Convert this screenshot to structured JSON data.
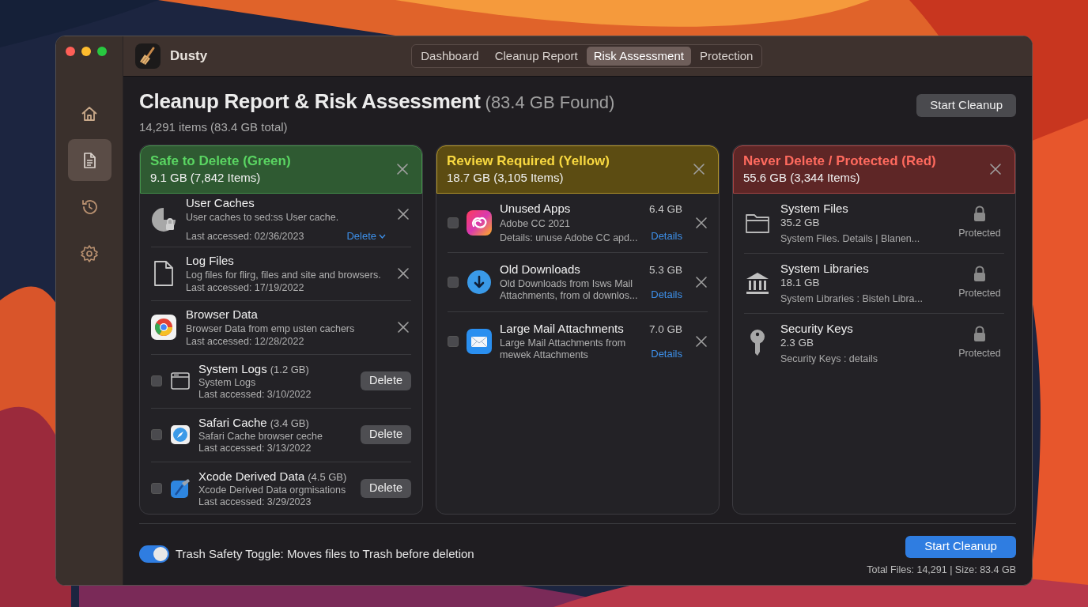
{
  "app": {
    "name": "Dusty"
  },
  "tabs": [
    {
      "label": "Dashboard",
      "selected": false
    },
    {
      "label": "Cleanup Report",
      "selected": false
    },
    {
      "label": "Risk Assessment",
      "selected": true
    },
    {
      "label": "Protection",
      "selected": false
    }
  ],
  "sidebar": {
    "items": [
      {
        "kind": "home",
        "selected": false
      },
      {
        "kind": "report",
        "selected": true
      },
      {
        "kind": "history",
        "selected": false
      },
      {
        "kind": "settings",
        "selected": false
      }
    ]
  },
  "header": {
    "title": "Cleanup Report & Risk Assessment",
    "found": "(83.4 GB Found)",
    "subtitle": "14,291 items (83.4 GB total)",
    "button": "Start Cleanup"
  },
  "columns": [
    {
      "color": "#5ad562",
      "title": "Safe to Delete (Green)",
      "summary": "9.1 GB (7,842 Items)",
      "items": [
        {
          "kind": "dismiss",
          "name": "User Caches",
          "description": "User caches to sed:ss User cache.",
          "accessed": "Last accessed: 02/36/2023",
          "action": "Delete"
        },
        {
          "kind": "dismiss",
          "name": "Log Files",
          "description": "Log files for flirg, files and site and browsers.",
          "accessed": "Last accessed: 17/19/2022"
        },
        {
          "kind": "dismiss",
          "name": "Browser Data",
          "description": "Browser Data from emp usten cachers",
          "accessed": "Last accessed: 12/28/2022"
        },
        {
          "kind": "check",
          "name": "System Logs",
          "size": "(1.2 GB)",
          "description": "System Logs",
          "accessed": "Last accessed: 3/10/2022",
          "checked": false,
          "action": "Delete"
        },
        {
          "kind": "check",
          "name": "Safari Cache",
          "size": "(3.4 GB)",
          "description": "Safari Cache browser ceche",
          "accessed": "Last accessed: 3/13/2022",
          "checked": false,
          "action": "Delete"
        },
        {
          "kind": "check",
          "name": "Xcode Derived Data",
          "size": "(4.5 GB)",
          "description": "Xcode Derived Data orgmisations",
          "accessed": "Last accessed: 3/29/2023",
          "checked": false,
          "action": "Delete"
        }
      ]
    },
    {
      "color": "#f8d840",
      "title": "Review Required (Yellow)",
      "summary": "18.7 GB (3,105 Items)",
      "items": [
        {
          "kind": "review",
          "name": "Unused Apps",
          "size": "6.4 GB",
          "description": "Adobe CC 2021",
          "detail": "Details: unuse Adobe CC apd...",
          "link": "Details",
          "checked": false
        },
        {
          "kind": "review",
          "name": "Old Downloads",
          "size": "5.3 GB",
          "description": "Old Downloads from Isws Mail Attachments, from ol downlos...",
          "link": "Details",
          "checked": false
        },
        {
          "kind": "review",
          "name": "Large Mail Attachments",
          "size": "7.0 GB",
          "description": "Large Mail Attachments from mewek Attachments",
          "link": "Details",
          "checked": false
        }
      ]
    },
    {
      "color": "#ff6a5e",
      "title": "Never Delete / Protected (Red)",
      "summary": "55.6 GB (3,344 Items)",
      "items": [
        {
          "kind": "protected",
          "name": "System Files",
          "size": "35.2 GB",
          "description": "System Files.  Details | Blanen...",
          "status": "Protected"
        },
        {
          "kind": "protected",
          "name": "System Libraries",
          "size": "18.1 GB",
          "description": "System Libraries : Bisteh Libra...",
          "status": "Protected"
        },
        {
          "kind": "protected",
          "name": "Security Keys",
          "size": "2.3 GB",
          "description": "Security Keys : details",
          "status": "Protected"
        }
      ]
    }
  ],
  "footer": {
    "toggle": {
      "label": "Trash Safety Toggle: Moves files to Trash before deletion",
      "on": true
    },
    "button": "Start Cleanup",
    "totals": "Total Files: 14,291 | Size: 83.4 GB"
  }
}
